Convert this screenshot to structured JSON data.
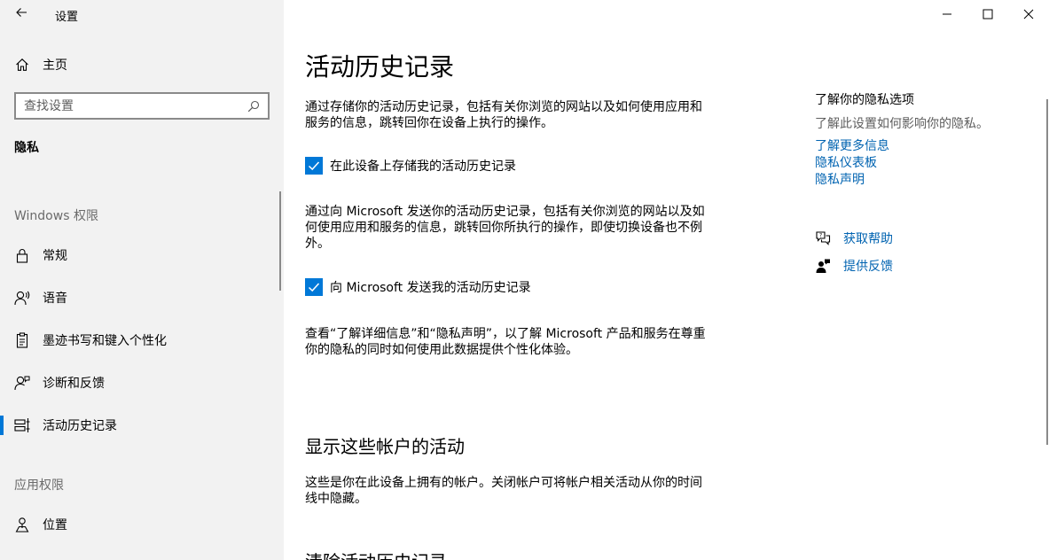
{
  "window": {
    "title": "设置",
    "controls": [
      "minimize",
      "maximize",
      "close"
    ]
  },
  "sidebar": {
    "home_label": "主页",
    "search": {
      "placeholder": "查找设置",
      "value": ""
    },
    "current_section": "隐私",
    "group_windows": "Windows 权限",
    "items": [
      {
        "label": "常规",
        "icon": "lock-icon"
      },
      {
        "label": "语音",
        "icon": "speech-icon"
      },
      {
        "label": "墨迹书写和键入个性化",
        "icon": "clipboard-icon"
      },
      {
        "label": "诊断和反馈",
        "icon": "person-feedback-icon"
      },
      {
        "label": "活动历史记录",
        "icon": "timeline-icon",
        "selected": true
      }
    ],
    "group_app": "应用权限",
    "app_items": [
      {
        "label": "位置",
        "icon": "location-icon"
      }
    ]
  },
  "main": {
    "title": "活动历史记录",
    "para1": "通过存储你的活动历史记录，包括有关你浏览的网站以及如何使用应用和服务的信息，跳转回你在设备上执行的操作。",
    "checkbox1": {
      "label": "在此设备上存储我的活动历史记录",
      "checked": true
    },
    "para2": "通过向 Microsoft 发送你的活动历史记录，包括有关你浏览的网站以及如何使用应用和服务的信息，跳转回你所执行的操作，即使切换设备也不例外。",
    "checkbox2": {
      "label": "向 Microsoft 发送我的活动历史记录",
      "checked": true
    },
    "para3": "查看“了解详细信息”和“隐私声明”，以了解 Microsoft 产品和服务在尊重你的隐私的同时如何使用此数据提供个性化体验。",
    "section2_title": "显示这些帐户的活动",
    "para4": "这些是你在此设备上拥有的帐户。关闭帐户可将帐户相关活动从你的时间线中隐藏。",
    "section3_title": "清除活动历史记录"
  },
  "right": {
    "title": "了解你的隐私选项",
    "desc": "了解此设置如何影响你的隐私。",
    "links": [
      "了解更多信息",
      "隐私仪表板",
      "隐私声明"
    ],
    "help_label": "获取帮助",
    "feedback_label": "提供反馈"
  },
  "colors": {
    "accent": "#0078d7",
    "link": "#0063b1",
    "sidebar_bg": "#f2f2f2"
  }
}
